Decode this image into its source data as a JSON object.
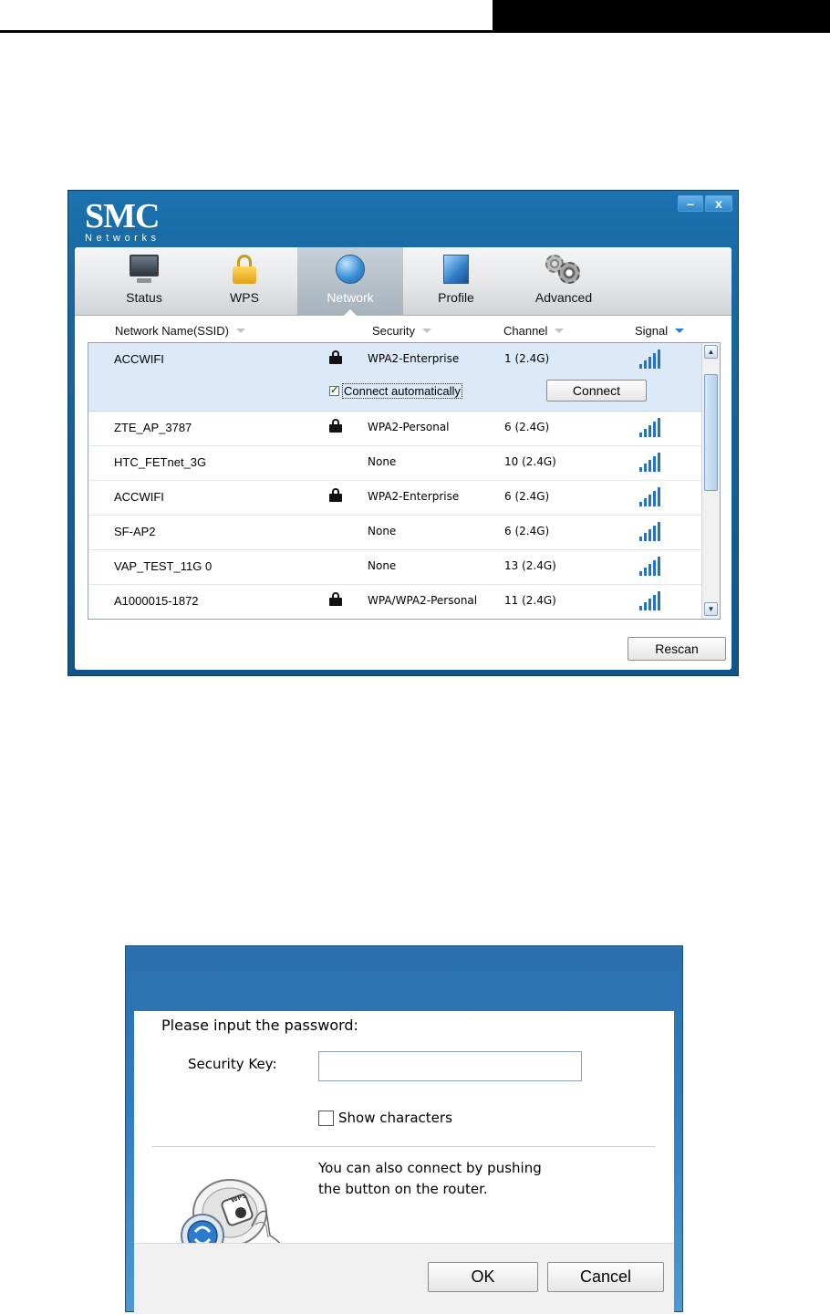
{
  "smc_window": {
    "logo_text": "SMC",
    "logo_subtext": "Networks",
    "minimize_label": "–",
    "close_label": "x",
    "toolbar": [
      {
        "label": "Status",
        "icon": "monitor-icon"
      },
      {
        "label": "WPS",
        "icon": "lock-icon"
      },
      {
        "label": "Network",
        "icon": "globe-icon",
        "active": true
      },
      {
        "label": "Profile",
        "icon": "profile-icon"
      },
      {
        "label": "Advanced",
        "icon": "gears-icon"
      }
    ],
    "columns": {
      "ssid": "Network Name(SSID)",
      "security": "Security",
      "channel": "Channel",
      "signal": "Signal"
    },
    "networks": [
      {
        "ssid": "ACCWIFI",
        "locked": true,
        "security": "WPA2-Enterprise",
        "channel": "1 (2.4G)",
        "selected": true
      },
      {
        "ssid": "ZTE_AP_3787",
        "locked": true,
        "security": "WPA2-Personal",
        "channel": "6 (2.4G)"
      },
      {
        "ssid": "HTC_FETnet_3G",
        "locked": false,
        "security": "None",
        "channel": "10 (2.4G)"
      },
      {
        "ssid": "ACCWIFI",
        "locked": true,
        "security": "WPA2-Enterprise",
        "channel": "6 (2.4G)"
      },
      {
        "ssid": "SF-AP2",
        "locked": false,
        "security": "None",
        "channel": "6 (2.4G)"
      },
      {
        "ssid": "VAP_TEST_11G 0",
        "locked": false,
        "security": "None",
        "channel": "13 (2.4G)"
      },
      {
        "ssid": "A1000015-1872",
        "locked": true,
        "security": "WPA/WPA2-Personal",
        "channel": "11 (2.4G)"
      }
    ],
    "selected_row": {
      "connect_automatically_label": "Connect automatically",
      "connect_automatically_checked": true,
      "connect_button": "Connect"
    },
    "rescan_button": "Rescan",
    "accent_color": "#2374c9"
  },
  "password_dialog": {
    "prompt": "Please input the password:",
    "security_key_label": "Security Key:",
    "security_key_value": "",
    "show_characters_label": "Show characters",
    "show_characters_checked": false,
    "hint_line1": "You can also connect by pushing",
    "hint_line2": "the button on the router.",
    "wps_badge_text": "WPS",
    "ok_button": "OK",
    "cancel_button": "Cancel"
  }
}
